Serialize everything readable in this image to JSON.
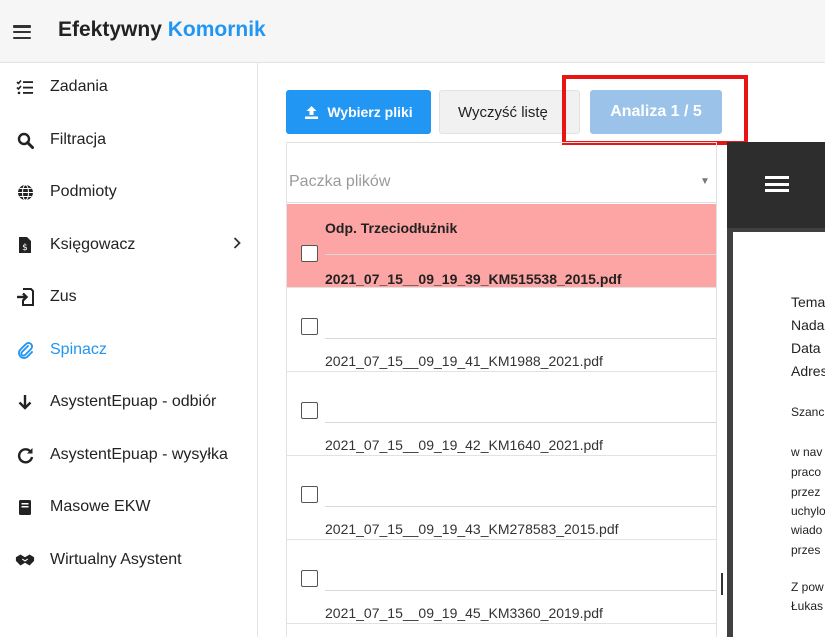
{
  "header": {
    "brand_part1": "Efektywny",
    "brand_part2": "Komornik",
    "brand_accent_color": "#2196f3",
    "menu_icon": "hamburger-icon"
  },
  "sidebar": {
    "items": [
      {
        "label": "Zadania",
        "icon": "list-check-icon"
      },
      {
        "label": "Filtracja",
        "icon": "search-icon"
      },
      {
        "label": "Podmioty",
        "icon": "globe-icon"
      },
      {
        "label": "Księgowacz",
        "icon": "receipt-icon",
        "has_submenu": true
      },
      {
        "label": "Zus",
        "icon": "sign-in-icon"
      },
      {
        "label": "Spinacz",
        "icon": "paperclip-icon",
        "active": true
      },
      {
        "label": "AsystentEpuap - odbiór",
        "icon": "arrow-down-icon"
      },
      {
        "label": "AsystentEpuap - wysyłka",
        "icon": "redo-icon"
      },
      {
        "label": "Masowe EKW",
        "icon": "book-icon"
      },
      {
        "label": "Wirtualny Asystent",
        "icon": "handshake-icon"
      }
    ]
  },
  "toolbar": {
    "upload_label": "Wybierz pliki",
    "upload_icon": "upload-icon",
    "clear_label": "Wyczyść listę",
    "analyze_label": "Analiza 1 / 5"
  },
  "file_select": {
    "placeholder": "Paczka plików"
  },
  "files": [
    {
      "tag": "Odp. Trzeciodłużnik",
      "name": "2021_07_15__09_19_39_KM515538_2015.pdf",
      "selected": true
    },
    {
      "tag": "",
      "name": "2021_07_15__09_19_41_KM1988_2021.pdf",
      "selected": false
    },
    {
      "tag": "",
      "name": "2021_07_15__09_19_42_KM1640_2021.pdf",
      "selected": false
    },
    {
      "tag": "",
      "name": "2021_07_15__09_19_43_KM278583_2015.pdf",
      "selected": false
    },
    {
      "tag": "",
      "name": "2021_07_15__09_19_45_KM3360_2019.pdf",
      "selected": false
    }
  ],
  "preview": {
    "menu_icon": "hamburger-icon",
    "lines": [
      "Tema",
      "Nada",
      "Data",
      "Adres",
      "Szanc",
      "w nav",
      "praco",
      "przez",
      "uchylo",
      "wiado",
      "przes",
      "Z pow",
      "Łukas"
    ]
  }
}
